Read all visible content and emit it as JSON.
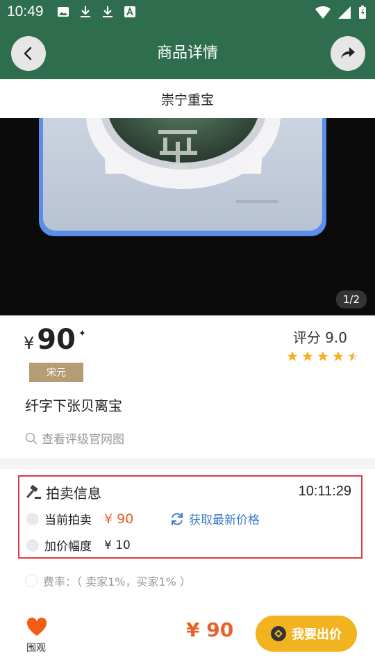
{
  "status_bar": {
    "time": "10:49"
  },
  "app_bar": {
    "title": "商品详情"
  },
  "subtitle": "崇宁重宝",
  "gallery": {
    "counter": "1/2"
  },
  "price": {
    "currency": "¥",
    "amount": "90",
    "mark": "✦"
  },
  "rating": {
    "label": "评分 9.0",
    "value": 4.5,
    "max": 5
  },
  "era_tag": "宋元",
  "item_name": "纤字下张贝离宝",
  "grading_link": "查看评级官网图",
  "auction": {
    "title": "拍卖信息",
    "countdown": "10:11:29",
    "current_label": "当前拍卖",
    "current_price": "¥ 90",
    "refresh_label": "获取最新价格",
    "increment_label": "加价幅度",
    "increment_value": "¥ 10"
  },
  "fee": "费率：（ 卖家1%，买家1% ）",
  "bottom": {
    "watch_label": "围观",
    "price": "¥ 90",
    "bid_label": "我要出价"
  },
  "colors": {
    "primary": "#2e6e4e",
    "accent_orange": "#e8602a",
    "bid_yellow": "#f3b321",
    "tag_gold": "#b49d72",
    "link_blue": "#3b7bc7",
    "highlight_red": "#e0383e"
  }
}
